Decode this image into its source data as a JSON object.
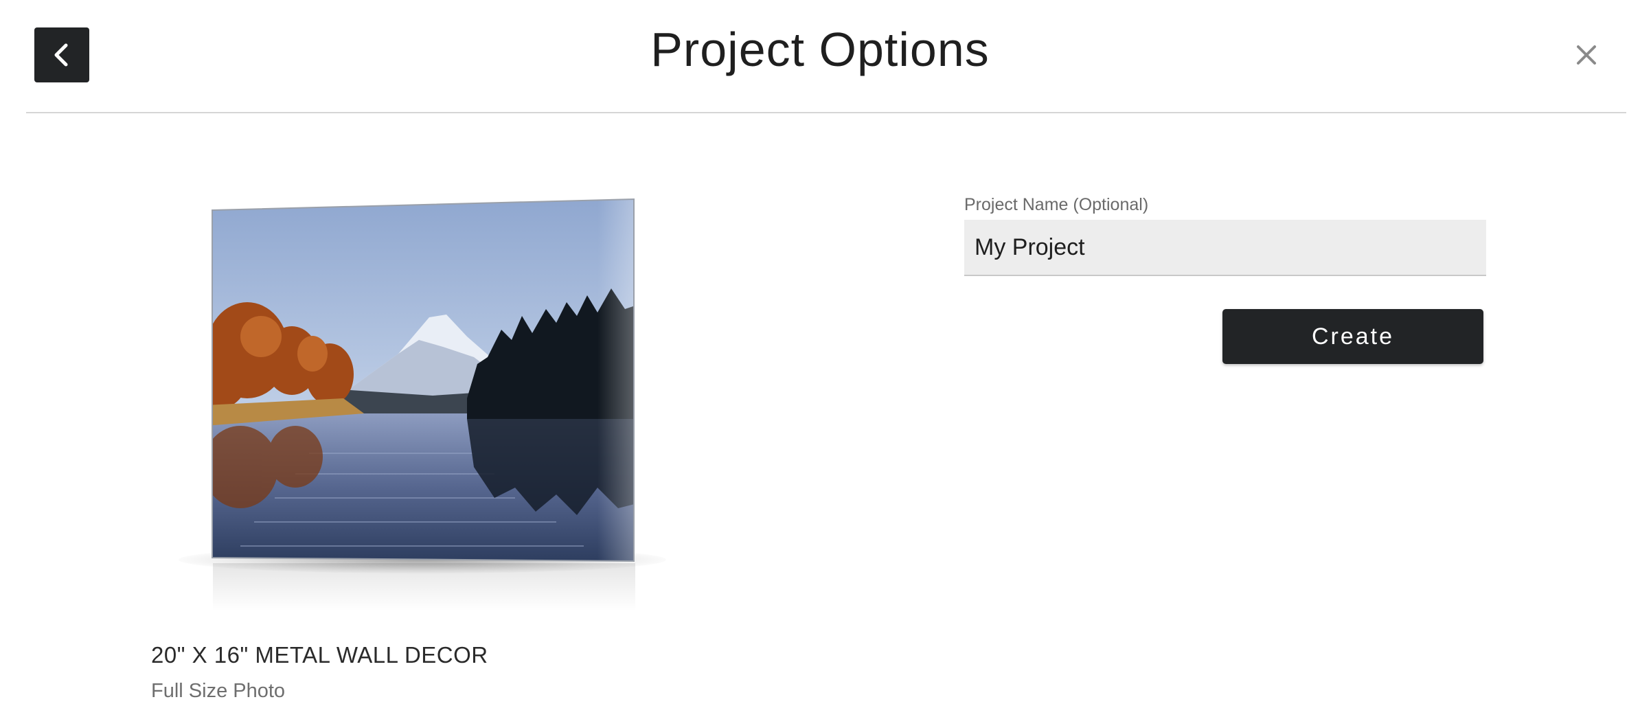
{
  "header": {
    "title": "Project Options",
    "back_icon": "chevron-left-icon",
    "close_icon": "close-icon"
  },
  "product": {
    "title": "20\" X 16\" METAL WALL DECOR",
    "subtitle": "Full Size Photo",
    "image_subject": "lake-mountain-photo"
  },
  "form": {
    "project_name_label": "Project Name (Optional)",
    "project_name_value": "My Project",
    "create_label": "Create"
  },
  "colors": {
    "button_dark": "#222426",
    "input_bg": "#ededed",
    "divider": "#d5d5d5"
  }
}
